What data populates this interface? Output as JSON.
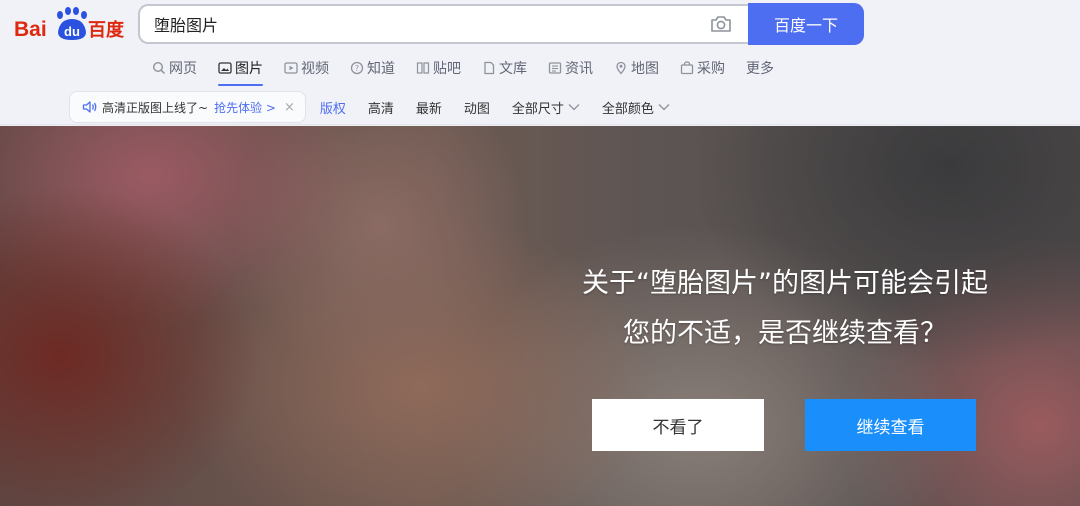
{
  "logo": {
    "text_bai": "Bai",
    "text_du": "du",
    "text_cn": "百度"
  },
  "search": {
    "query": "堕胎图片",
    "button_label": "百度一下"
  },
  "nav": {
    "items": [
      {
        "label": "网页",
        "icon": "search-icon"
      },
      {
        "label": "图片",
        "icon": "image-icon"
      },
      {
        "label": "视频",
        "icon": "video-icon"
      },
      {
        "label": "知道",
        "icon": "question-icon"
      },
      {
        "label": "贴吧",
        "icon": "tieba-icon"
      },
      {
        "label": "文库",
        "icon": "document-icon"
      },
      {
        "label": "资讯",
        "icon": "news-icon"
      },
      {
        "label": "地图",
        "icon": "map-icon"
      },
      {
        "label": "采购",
        "icon": "shopping-icon"
      },
      {
        "label": "更多",
        "icon": ""
      }
    ],
    "active": "图片"
  },
  "notice": {
    "text": "高清正版图上线了~",
    "link": "抢先体验 >",
    "close": "×"
  },
  "filters": {
    "items": [
      "版权",
      "高清",
      "最新",
      "动图"
    ],
    "size_dropdown": "全部尺寸",
    "color_dropdown": "全部颜色"
  },
  "dialog": {
    "line1": "关于“堕胎图片”的图片可能会引起",
    "line2": "您的不适，是否继续查看？",
    "decline_label": "不看了",
    "continue_label": "继续查看"
  },
  "colors": {
    "brand_blue": "#4e6ef2",
    "brand_red": "#de2910",
    "continue_blue": "#1a8ffb"
  }
}
